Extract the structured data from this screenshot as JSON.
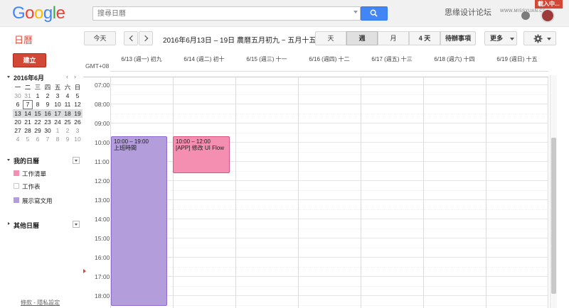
{
  "header": {
    "logo": "Google",
    "search": {
      "placeholder": "搜尋日曆"
    },
    "watermark": "思缘设计论坛",
    "watermark_url": "WWW.MISSYUAN.COM",
    "loading_badge": "載入中..."
  },
  "toolbar": {
    "app_title": "日曆",
    "today": "今天",
    "date_range": "2016年6月13日 – 19日 農曆五月初九 ~ 五月十五",
    "views": {
      "day": "天",
      "week": "週",
      "month": "月",
      "four_days": "4 天",
      "agenda": "待辦事項"
    },
    "more": "更多"
  },
  "sidebar": {
    "create": "建立",
    "mini_month": {
      "title": "2016年6月",
      "prev": "‹",
      "next": "›",
      "weekdays": [
        "一",
        "二",
        "三",
        "四",
        "五",
        "六",
        "日"
      ],
      "weeks": [
        [
          "30",
          "31",
          "1",
          "2",
          "3",
          "4",
          "5"
        ],
        [
          "6",
          "7",
          "8",
          "9",
          "10",
          "11",
          "12"
        ],
        [
          "13",
          "14",
          "15",
          "16",
          "17",
          "18",
          "19"
        ],
        [
          "20",
          "21",
          "22",
          "23",
          "24",
          "25",
          "26"
        ],
        [
          "27",
          "28",
          "29",
          "30",
          "1",
          "2",
          "3"
        ],
        [
          "4",
          "5",
          "6",
          "7",
          "8",
          "9",
          "10"
        ]
      ]
    },
    "my_calendars": {
      "title": "我的日曆",
      "items": [
        {
          "label": "工作清單",
          "color": "#f48fb1"
        },
        {
          "label": "工作表",
          "color": "#ffffff"
        },
        {
          "label": "展示寫文用",
          "color": "#b39ddb"
        }
      ]
    },
    "other_calendars": {
      "title": "其他日曆"
    },
    "footer": "條款 - 隱私設定"
  },
  "calendar": {
    "timezone": "GMT+08",
    "days": [
      "6/13 (週一) 初九",
      "6/14 (週二) 初十",
      "6/15 (週三) 十一",
      "6/16 (週四) 十二",
      "6/17 (週五) 十三",
      "6/18 (週六) 十四",
      "6/19 (週日) 十五"
    ],
    "hours": [
      "07:00",
      "08:00",
      "09:00",
      "10:00",
      "11:00",
      "12:00",
      "13:00",
      "14:00",
      "15:00",
      "16:00",
      "17:00",
      "18:00"
    ],
    "events": [
      {
        "time": "10:00 – 19:00",
        "title": "上班時間",
        "color": "#b39ddb"
      },
      {
        "time": "10:00 – 12:00",
        "title": "[APP] 修改 UI Flow",
        "color": "#f48fb1"
      }
    ]
  }
}
